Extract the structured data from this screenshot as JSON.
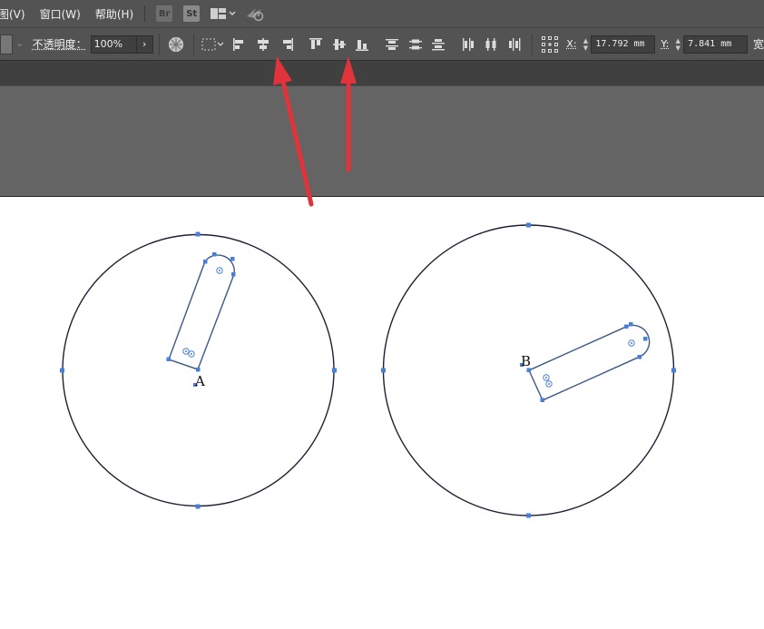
{
  "menu": {
    "items": [
      "图(V)",
      "窗口(W)",
      "帮助(H)"
    ],
    "badges": {
      "bridge": "Br",
      "stock": "St"
    }
  },
  "control": {
    "opacity_label": "不透明度：",
    "opacity_value": "100%",
    "x_label": "X:",
    "x_value": "17.792 mm",
    "y_label": "Y:",
    "y_value": "7.841 mm",
    "width_label": "宽"
  },
  "artboard": {
    "label_a": "A",
    "label_b": "B"
  },
  "colors": {
    "selection": "#4a7fd8",
    "arrow": "#e0343c",
    "ui_bg": "#535353"
  }
}
